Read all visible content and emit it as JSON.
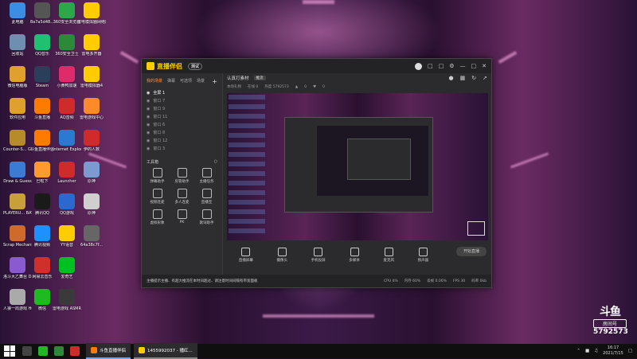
{
  "desktop": {
    "icons_col1": [
      {
        "label": "此电脑",
        "icon": "computer-icon",
        "color": "#3a8ee6"
      },
      {
        "label": "回收站",
        "icon": "recycle-bin-icon",
        "color": "#6f8fb0"
      },
      {
        "label": "微信电脑版",
        "icon": "folder-icon",
        "color": "#e0a030"
      },
      {
        "label": "软件应用",
        "icon": "folder-icon",
        "color": "#e0a030"
      },
      {
        "label": "Counter-S... Global Off...",
        "icon": "csgo-icon",
        "color": "#b78a2a"
      },
      {
        "label": "Draw & Guess",
        "icon": "draw-guess-icon",
        "color": "#3a7bd5"
      },
      {
        "label": "PLAYERU... BATTLEGR...",
        "icon": "pubg-icon",
        "color": "#c7a03a"
      },
      {
        "label": "Scrap Mechanic",
        "icon": "scrap-mechanic-icon",
        "color": "#d06a2a"
      },
      {
        "label": "洛斗大乙舞台 Dance of F...",
        "icon": "dance-icon",
        "color": "#8a5ad0"
      },
      {
        "label": "人狼一局游戏 Human Fa...",
        "icon": "human-fall-icon",
        "color": "#aaaaaa"
      }
    ],
    "icons_col2": [
      {
        "label": "8a7a5d48...",
        "icon": "file-icon",
        "color": "#555555"
      },
      {
        "label": "QQ音乐",
        "icon": "qq-music-icon",
        "color": "#20c070"
      },
      {
        "label": "Steam",
        "icon": "steam-icon",
        "color": "#2a3f5a"
      },
      {
        "label": "斗鱼直播",
        "icon": "douyu-icon",
        "color": "#ff7a00"
      },
      {
        "label": "斗鱼直播伴侣",
        "icon": "douyu-companion-icon",
        "color": "#ff7a00"
      },
      {
        "label": "巴啦下",
        "icon": "app-icon",
        "color": "#ff9a30"
      },
      {
        "label": "腾讯QQ",
        "icon": "qq-icon",
        "color": "#1a1a1a"
      },
      {
        "label": "腾讯视频",
        "icon": "tencent-video-icon",
        "color": "#1e90ff"
      },
      {
        "label": "网易云音乐",
        "icon": "netease-music-icon",
        "color": "#d0302a"
      },
      {
        "label": "微信",
        "icon": "wechat-icon",
        "color": "#1fb922"
      }
    ],
    "icons_col3": [
      {
        "label": "360安全浏览器",
        "icon": "360-browser-icon",
        "color": "#2aa84a"
      },
      {
        "label": "360安全卫士",
        "icon": "360-guard-icon",
        "color": "#2a8a3a"
      },
      {
        "label": "小黄鸭加速",
        "icon": "duck-icon",
        "color": "#e02a6a"
      },
      {
        "label": "AQ音频",
        "icon": "aq-icon",
        "color": "#d02a2a"
      },
      {
        "label": "Internet Explorer",
        "icon": "ie-icon",
        "color": "#2a7ad0"
      },
      {
        "label": "Launcher",
        "icon": "launcher-icon",
        "color": "#d02a2a"
      },
      {
        "label": "QQ游戏",
        "icon": "qq-game-icon",
        "color": "#2a6ad0"
      },
      {
        "label": "YY语音",
        "icon": "yy-icon",
        "color": "#ffcc00"
      },
      {
        "label": "爱奇艺",
        "icon": "iqiyi-icon",
        "color": "#00c020"
      },
      {
        "label": "雷电游戏 ASMR的...",
        "icon": "game-icon",
        "color": "#3a3a3a"
      }
    ],
    "icons_col4": [
      {
        "label": "雷电模拟器网络版",
        "icon": "emulator-icon",
        "color": "#ffcc00"
      },
      {
        "label": "雷电多开器",
        "icon": "multi-icon",
        "color": "#ffcc00"
      },
      {
        "label": "雷电模拟器4",
        "icon": "emulator-icon",
        "color": "#ffcc00"
      },
      {
        "label": "雷电游戏中心",
        "icon": "game-center-icon",
        "color": "#ff8a2a"
      },
      {
        "label": "伊的人数",
        "icon": "app-icon",
        "color": "#d02a2a"
      },
      {
        "label": "原神",
        "icon": "genshin-icon",
        "color": "#7a9ad0"
      },
      {
        "label": "原神",
        "icon": "genshin-icon",
        "color": "#cfcfcf"
      },
      {
        "label": "64a38c7f...",
        "icon": "file-icon",
        "color": "#666666"
      }
    ]
  },
  "app": {
    "title": "直播伴侣",
    "version": "测试",
    "sidebar_tabs": [
      "我的场景",
      "弹幕",
      "可选项",
      "场景"
    ],
    "scenes": [
      "全屏 1",
      "窗口 7",
      "窗口 9",
      "窗口 11",
      "窗口 6",
      "窗口 8",
      "窗口 12",
      "窗口 3"
    ],
    "toolbox_title": "工具箱",
    "tools": [
      "弹幕助手",
      "房管助手",
      "主播任务",
      "视频连麦",
      "多人连麦",
      "直播宝",
      "虚拟形象",
      "PK",
      "歌词助手"
    ],
    "main_title": "认真打素材",
    "main_tag": "推流",
    "sub_info": [
      "本场礼物",
      "在线 0",
      "热度 5792573",
      "0",
      "0"
    ],
    "controls": [
      "直播屏幕",
      "摄像头",
      "手机投屏",
      "多媒体",
      "麦克风",
      "扬声器"
    ],
    "start_label": "开始直播",
    "status_notice": "主播提示主播、有超大推流在本时间超过、请注意时间间隔有带宽面板",
    "status_stats": [
      "CPU 4%",
      "内存 60%",
      "丢帧 0.00%",
      "FPS 30",
      "码率 0kb"
    ]
  },
  "douyu": {
    "brand": "斗鱼",
    "room_label": "房间号",
    "room_number": "5792573"
  },
  "taskbar": {
    "apps": [
      {
        "label": "斗鱼直播伴侣",
        "icon": "douyu-icon"
      },
      {
        "label": "1455992037 - 播红...",
        "icon": "chat-icon"
      }
    ],
    "time": "16:17",
    "date": "2021/7/15"
  }
}
